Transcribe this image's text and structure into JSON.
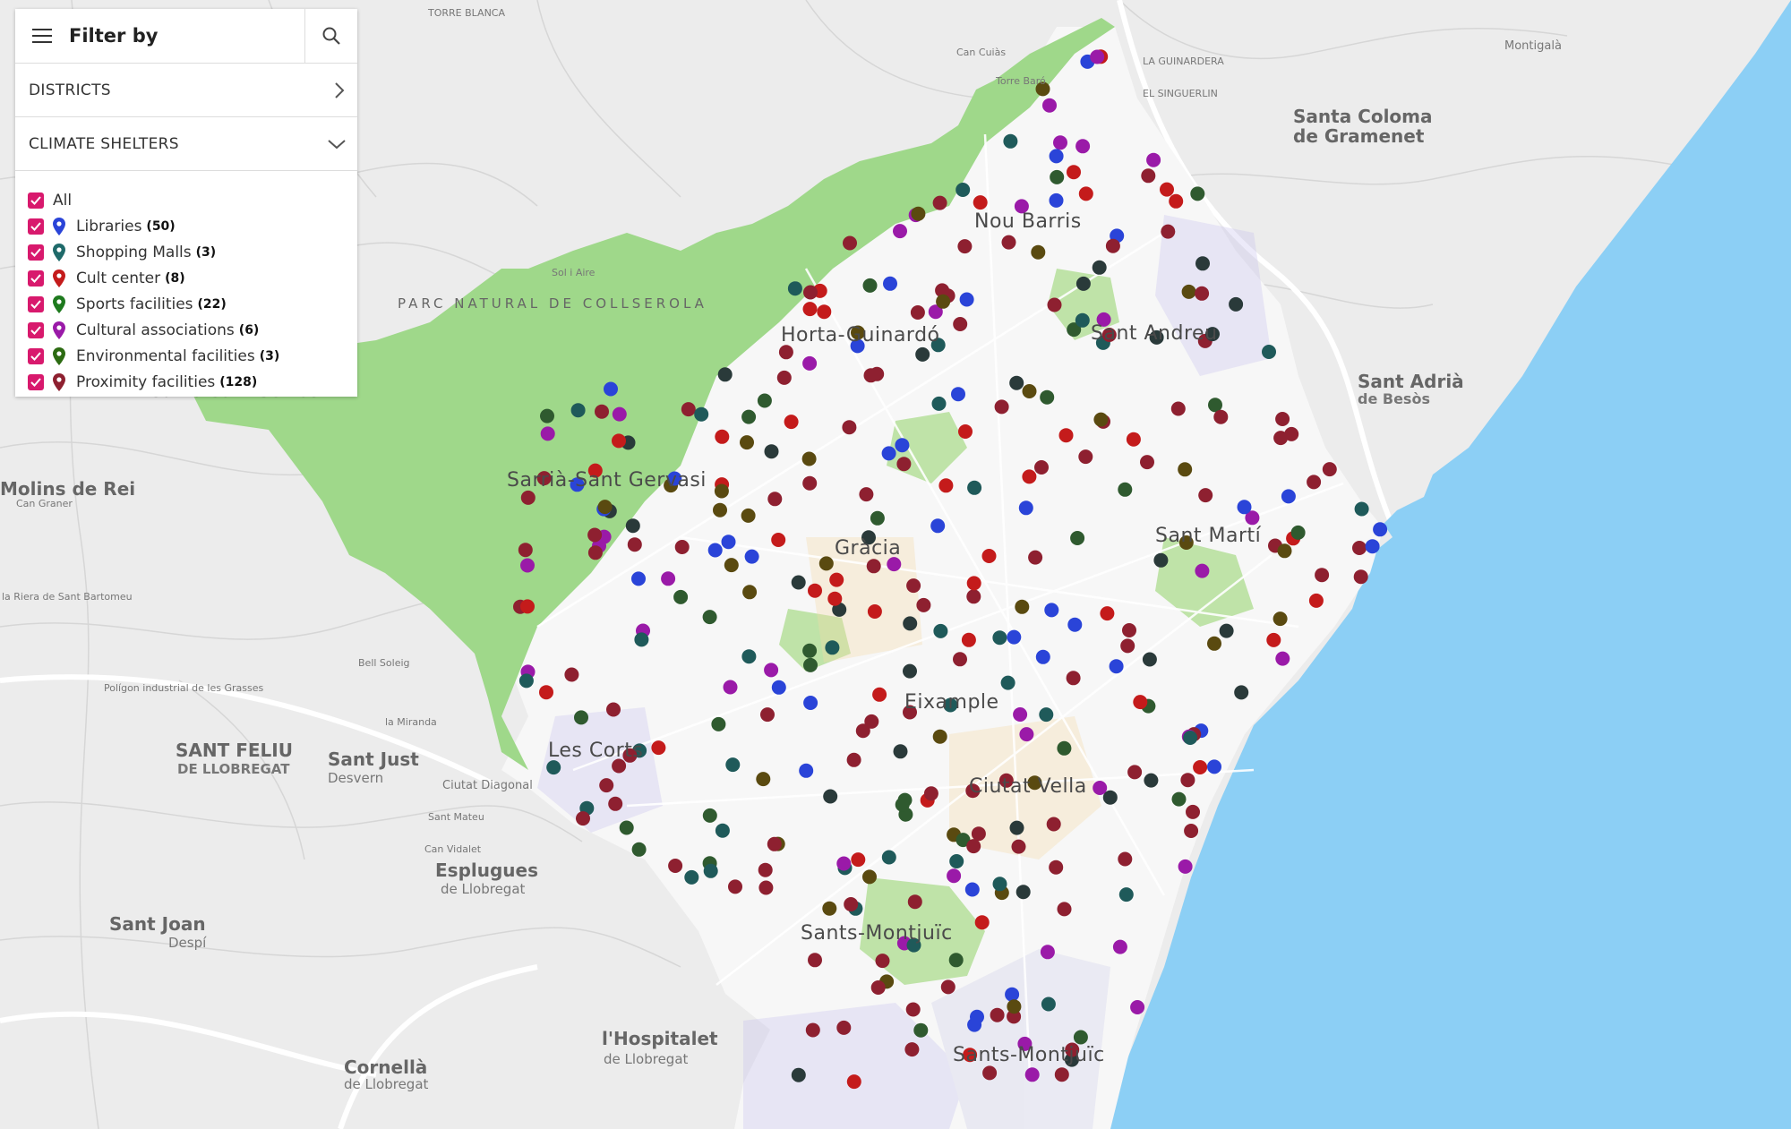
{
  "panel": {
    "title": "Filter by",
    "districts_label": "DISTRICTS",
    "shelters_label": "CLIMATE SHELTERS",
    "all_label": "All",
    "categories": [
      {
        "label": "Libraries",
        "count": "(50)",
        "color": "#2a44d8"
      },
      {
        "label": "Shopping Malls",
        "count": "(3)",
        "color": "#1f6a6a"
      },
      {
        "label": "Cult center",
        "count": "(8)",
        "color": "#c41b1b"
      },
      {
        "label": "Sports facilities",
        "count": "(22)",
        "color": "#1e7a1e"
      },
      {
        "label": "Cultural associations",
        "count": "(6)",
        "color": "#9a1aa8"
      },
      {
        "label": "Environmental facilities",
        "count": "(3)",
        "color": "#2c6b12"
      },
      {
        "label": "Proximity facilities",
        "count": "(128)",
        "color": "#8e2030"
      }
    ]
  },
  "map": {
    "colors": {
      "land": "#ececec",
      "park": "#9fd88a",
      "sea": "#8ccff5",
      "city": "#f7f7f7"
    },
    "labels": {
      "nou_barris": "Nou Barris",
      "sant_andreu": "Sant Andreu",
      "horta": "Horta-Guinardó",
      "sarria": "Sarrià-Sant Gervasi",
      "gracia": "Gràcia",
      "sant_marti": "Sant Martí",
      "eixample": "Eixample",
      "les_corts": "Les Corts",
      "ciutat_vella": "Ciutat Vella",
      "sants": "Sants-Montjuïc",
      "sants2": "Sants-Montjuïc",
      "santa_coloma_1": "Santa Coloma",
      "santa_coloma_2": "de Gramenet",
      "sant_adria_1": "Sant Adrià",
      "sant_adria_2": "de Besòs",
      "molins": "Molins de Rei",
      "sant_feliu_1": "SANT FELIU",
      "sant_feliu_2": "DE LLOBREGAT",
      "sant_just_1": "Sant Just",
      "sant_just_2": "Desvern",
      "esplugues_1": "Esplugues",
      "esplugues_2": "de Llobregat",
      "sant_joan_1": "Sant Joan",
      "sant_joan_2": "Despí",
      "hospitalet_1": "l'Hospitalet",
      "hospitalet_2": "de Llobregat",
      "cornella_1": "Cornellà",
      "cornella_2": "de Llobregat",
      "collserola": "PARC NATURAL DE COLLSEROLA",
      "sarria_top": "Sarrià-Sant Gervasi",
      "montigala": "Montigalà",
      "torre_blanca": "TORRE BLANCA",
      "la_guinardera": "LA GUINARDERA",
      "el_singuerlin": "EL SINGUERLIN",
      "can_cuias": "Can Cuiàs",
      "bell_soleig": "Bell Soleig",
      "torrent": "Torre Baró",
      "la_vallensana": "Sol i Aire",
      "can_vidalet": "Can Vidalet",
      "ciutat_diagonal": "Ciutat Diagonal",
      "la_miranda": "la Miranda",
      "sant_mateu": "Sant Mateu",
      "can_graner": "Can Graner",
      "la_riera": "la Riera de Sant Bartomeu",
      "poligon": "Polígon industrial de les Grasses"
    }
  }
}
